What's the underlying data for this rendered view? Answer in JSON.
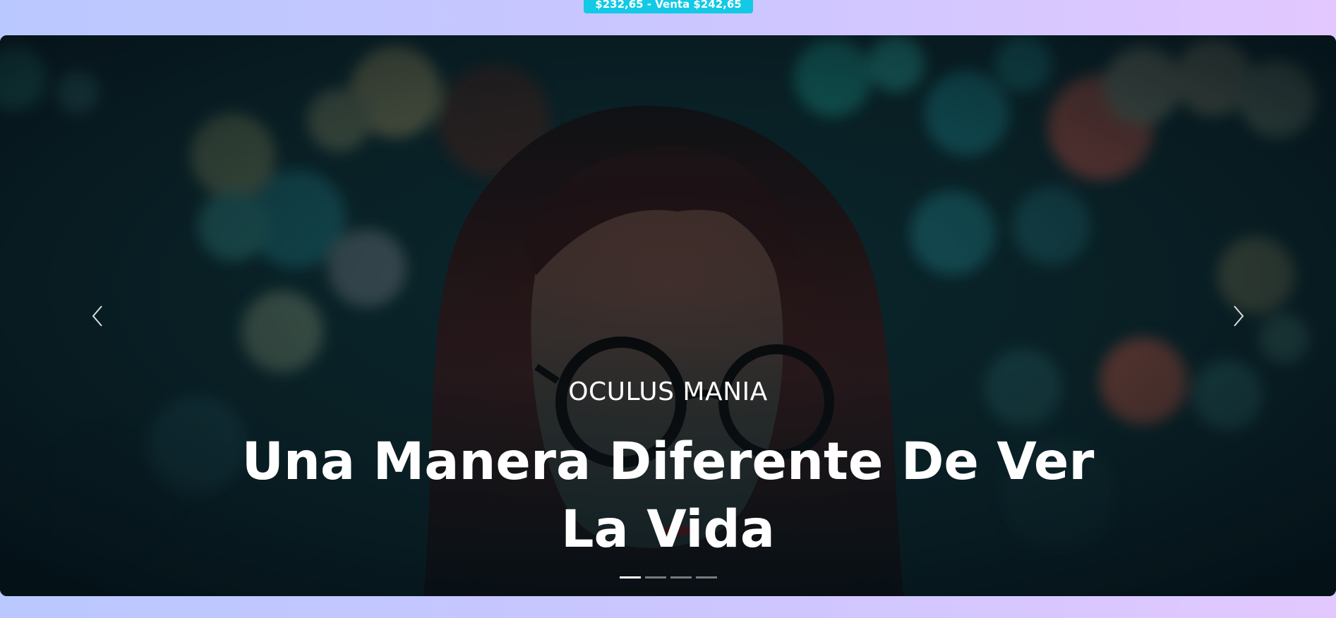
{
  "top_bar": {
    "exchange_rate": "$232,65 - Venta $242,65",
    "accent_color": "#12c9e6"
  },
  "hero": {
    "subtitle": "OCULUS MANIA",
    "headline": "Una Manera Diferente De Ver La Vida",
    "prev_icon": "chevron-left-icon",
    "next_icon": "chevron-right-icon",
    "slide_count": 4,
    "active_slide": 1
  }
}
